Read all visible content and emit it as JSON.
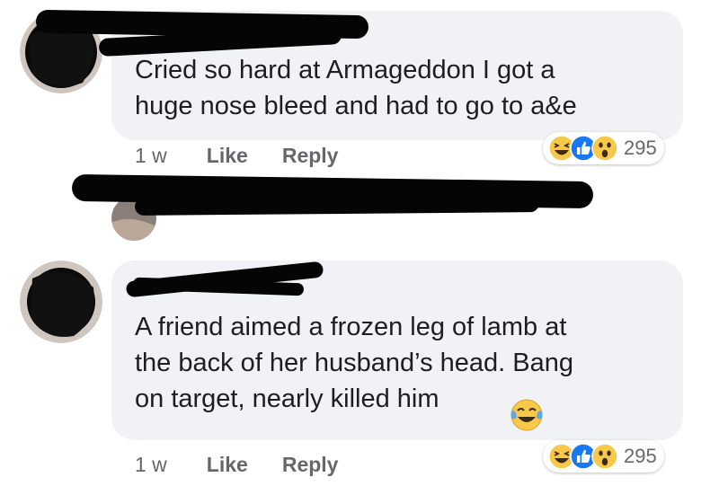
{
  "comments": [
    {
      "text": "Cried so hard at Armageddon I got a\nhuge nose bleed and had to go to a&e",
      "time": "1 w",
      "like_label": "Like",
      "reply_label": "Reply",
      "reaction_count": "295",
      "reactions": [
        "laugh-emoji-icon",
        "like-icon",
        "wow-emoji-icon"
      ]
    },
    {
      "text": "A friend aimed a frozen leg of lamb at\nthe back of her husband’s head. Bang\non target, nearly killed him",
      "time": "1 w",
      "like_label": "Like",
      "reply_label": "Reply",
      "reaction_count": "295",
      "reactions": [
        "laugh-emoji-icon",
        "like-icon",
        "wow-emoji-icon"
      ]
    }
  ],
  "colors": {
    "bubble": "#f0f2f5",
    "meta_text": "#65676b",
    "like_blue": "#1877f2",
    "emoji_yellow": "#f7c84a"
  }
}
